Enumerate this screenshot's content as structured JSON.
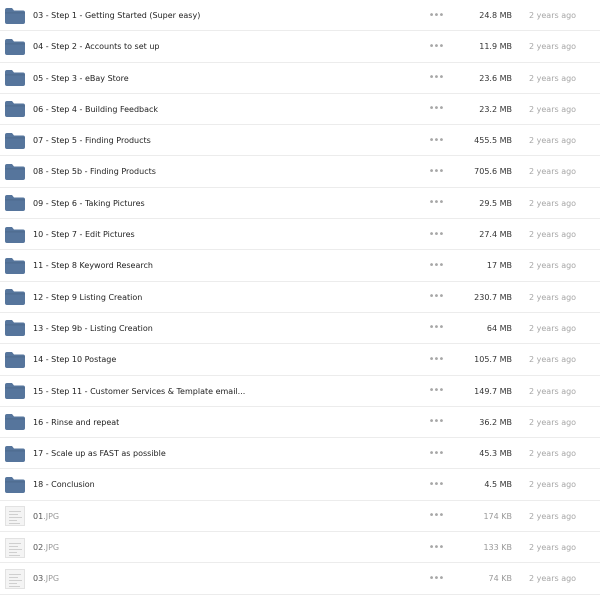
{
  "colors": {
    "folder": "#56759c",
    "row_divider": "#ececec",
    "muted_text": "#a6a6a6"
  },
  "rows": [
    {
      "kind": "folder",
      "icon": "folder-icon",
      "name": "03 - Step 1 - Getting Started (Super easy)",
      "size": "24.8 MB",
      "date": "2 years ago"
    },
    {
      "kind": "folder",
      "icon": "folder-icon",
      "name": "04 - Step 2 - Accounts to set up",
      "size": "11.9 MB",
      "date": "2 years ago"
    },
    {
      "kind": "folder",
      "icon": "folder-icon",
      "name": "05 - Step 3 - eBay Store",
      "size": "23.6 MB",
      "date": "2 years ago"
    },
    {
      "kind": "folder",
      "icon": "folder-icon",
      "name": "06 - Step 4 - Building Feedback",
      "size": "23.2 MB",
      "date": "2 years ago"
    },
    {
      "kind": "folder",
      "icon": "folder-icon",
      "name": "07 - Step 5 - Finding Products",
      "size": "455.5 MB",
      "date": "2 years ago"
    },
    {
      "kind": "folder",
      "icon": "folder-icon",
      "name": "08 - Step 5b - Finding Products",
      "size": "705.6 MB",
      "date": "2 years ago"
    },
    {
      "kind": "folder",
      "icon": "folder-icon",
      "name": "09 - Step 6 - Taking Pictures",
      "size": "29.5 MB",
      "date": "2 years ago"
    },
    {
      "kind": "folder",
      "icon": "folder-icon",
      "name": "10 - Step 7 - Edit Pictures",
      "size": "27.4 MB",
      "date": "2 years ago"
    },
    {
      "kind": "folder",
      "icon": "folder-icon",
      "name": "11 - Step 8 Keyword Research",
      "size": "17 MB",
      "date": "2 years ago"
    },
    {
      "kind": "folder",
      "icon": "folder-icon",
      "name": "12 - Step 9 Listing Creation",
      "size": "230.7 MB",
      "date": "2 years ago"
    },
    {
      "kind": "folder",
      "icon": "folder-icon",
      "name": "13 - Step 9b - Listing Creation",
      "size": "64 MB",
      "date": "2 years ago"
    },
    {
      "kind": "folder",
      "icon": "folder-icon",
      "name": "14 - Step 10 Postage",
      "size": "105.7 MB",
      "date": "2 years ago"
    },
    {
      "kind": "folder",
      "icon": "folder-icon",
      "name": "15 - Step 11 - Customer Services & Template email...",
      "size": "149.7 MB",
      "date": "2 years ago"
    },
    {
      "kind": "folder",
      "icon": "folder-icon",
      "name": "16 - Rinse and repeat",
      "size": "36.2 MB",
      "date": "2 years ago"
    },
    {
      "kind": "folder",
      "icon": "folder-icon",
      "name": "17 - Scale up as FAST as possible",
      "size": "45.3 MB",
      "date": "2 years ago"
    },
    {
      "kind": "folder",
      "icon": "folder-icon",
      "name": "18 - Conclusion",
      "size": "4.5 MB",
      "date": "2 years ago"
    },
    {
      "kind": "file",
      "icon": "image-thumbnail-icon",
      "name": "01",
      "ext": ".JPG",
      "size": "174 KB",
      "date": "2 years ago"
    },
    {
      "kind": "file",
      "icon": "image-thumbnail-icon",
      "name": "02",
      "ext": ".JPG",
      "size": "133 KB",
      "date": "2 years ago"
    },
    {
      "kind": "file",
      "icon": "image-thumbnail-icon",
      "name": "03",
      "ext": ".JPG",
      "size": "74 KB",
      "date": "2 years ago"
    }
  ]
}
